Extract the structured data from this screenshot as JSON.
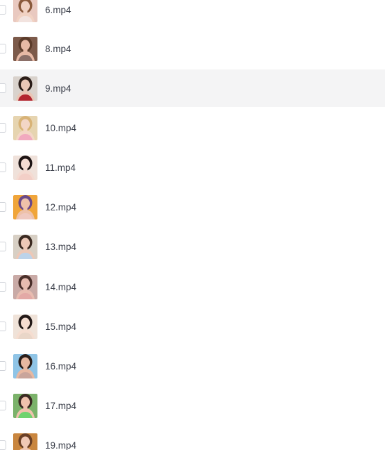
{
  "files": [
    {
      "name": "6.mp4",
      "thumb": {
        "bg": "#e9c9c0",
        "skin": "#f1d2c3",
        "hair": "#8a5a3c",
        "cloth": "#f2e3df"
      }
    },
    {
      "name": "8.mp4",
      "thumb": {
        "bg": "#7c5a4a",
        "skin": "#e7b9a5",
        "hair": "#5b3b2a",
        "cloth": "#8b6f68"
      }
    },
    {
      "name": "9.mp4",
      "thumb": {
        "bg": "#d9d2cc",
        "skin": "#e9c6b6",
        "hair": "#2b1d18",
        "cloth": "#b3252f"
      }
    },
    {
      "name": "10.mp4",
      "thumb": {
        "bg": "#e6d4b0",
        "skin": "#f3d6c6",
        "hair": "#d8b377",
        "cloth": "#f1a9bf"
      }
    },
    {
      "name": "11.mp4",
      "thumb": {
        "bg": "#efe1da",
        "skin": "#f4dbd2",
        "hair": "#1d1414",
        "cloth": "#f3cfc7"
      }
    },
    {
      "name": "12.mp4",
      "thumb": {
        "bg": "#f0a53a",
        "skin": "#eec1a9",
        "hair": "#6b4a8a",
        "cloth": "#efc9c0"
      }
    },
    {
      "name": "13.mp4",
      "thumb": {
        "bg": "#d7cfc4",
        "skin": "#ecc8b7",
        "hair": "#3b2a22",
        "cloth": "#bcd3ea"
      }
    },
    {
      "name": "14.mp4",
      "thumb": {
        "bg": "#c9aaa6",
        "skin": "#e8bcb0",
        "hair": "#4a2f2a",
        "cloth": "#e3a9a6"
      }
    },
    {
      "name": "15.mp4",
      "thumb": {
        "bg": "#efe2d8",
        "skin": "#f5ddd0",
        "hair": "#231a18",
        "cloth": "#e9d6c8"
      }
    },
    {
      "name": "16.mp4",
      "thumb": {
        "bg": "#8fc4e6",
        "skin": "#e7b8a1",
        "hair": "#2a1e1a",
        "cloth": "#c9a59b"
      }
    },
    {
      "name": "17.mp4",
      "thumb": {
        "bg": "#7bb26a",
        "skin": "#efc2ad",
        "hair": "#3a2a22",
        "cloth": "#6fd36f"
      }
    },
    {
      "name": "19.mp4",
      "thumb": {
        "bg": "#c9863f",
        "skin": "#f0c8b5",
        "hair": "#6a3f25",
        "cloth": "#d9a86a"
      }
    }
  ],
  "hovered_index": 2,
  "colors": {
    "row_hover_bg": "#f4f4f5",
    "filename_text": "#3b3f4a",
    "checkbox_border": "#cfd2d8"
  },
  "icons": {
    "checkbox": "checkbox-icon",
    "thumbnail": "video-thumbnail"
  }
}
